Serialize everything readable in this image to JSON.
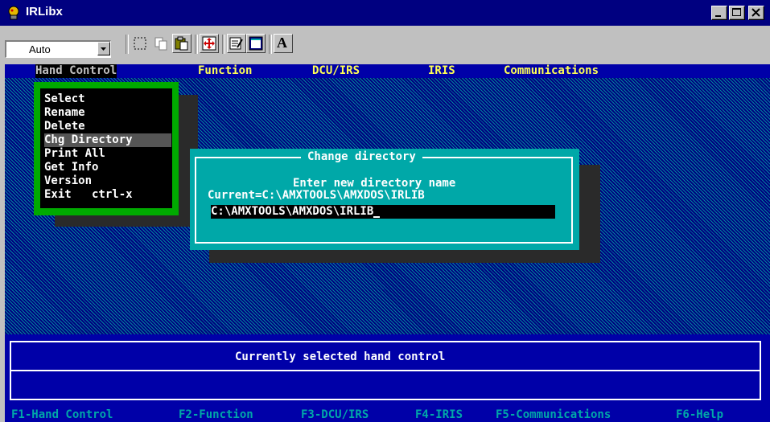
{
  "window": {
    "title": "IRLibx",
    "icon": "irlibx-app-icon",
    "controls": [
      "minimize-icon",
      "maximize-icon",
      "close-icon"
    ]
  },
  "toolbar": {
    "font_combo_value": "Auto",
    "buttons": [
      {
        "name": "mark-button",
        "icon": "mark-icon"
      },
      {
        "name": "copy-button",
        "icon": "copy-icon"
      },
      {
        "name": "paste-button",
        "icon": "paste-icon"
      },
      {
        "name": "full-screen-button",
        "icon": "full-screen-icon"
      },
      {
        "name": "properties-button",
        "icon": "properties-icon"
      },
      {
        "name": "background-button",
        "icon": "background-icon"
      },
      {
        "name": "font-button",
        "label": "A"
      }
    ]
  },
  "menubar": {
    "items": [
      "Hand Control",
      "Function",
      "DCU/IRS",
      "IRIS",
      "Communications"
    ],
    "active": "Hand Control"
  },
  "dropdown": {
    "items": [
      "Select",
      "Rename",
      "Delete",
      "Chg Directory",
      "Print All",
      "Get Info",
      "Version",
      "Exit   ctrl-x"
    ],
    "selected": "Chg Directory"
  },
  "dialog": {
    "title": "Change directory",
    "prompt": "Enter new directory name",
    "current": "Current=C:\\AMXTOOLS\\AMXDOS\\IRLIB",
    "input_value": "C:\\AMXTOOLS\\AMXDOS\\IRLIB"
  },
  "status": {
    "text": "Currently selected hand control",
    "detail": ""
  },
  "fkeys": [
    "F1-Hand Control",
    "F2-Function",
    "F3-DCU/IRS",
    "F4-IRIS",
    "F5-Communications",
    "F6-Help"
  ],
  "colors": {
    "dos_blue": "#0000a8",
    "dos_yellow": "#ffff55",
    "dos_cyan": "#00a8a8",
    "dos_green": "#00aa00",
    "title_bar": "#000080"
  }
}
